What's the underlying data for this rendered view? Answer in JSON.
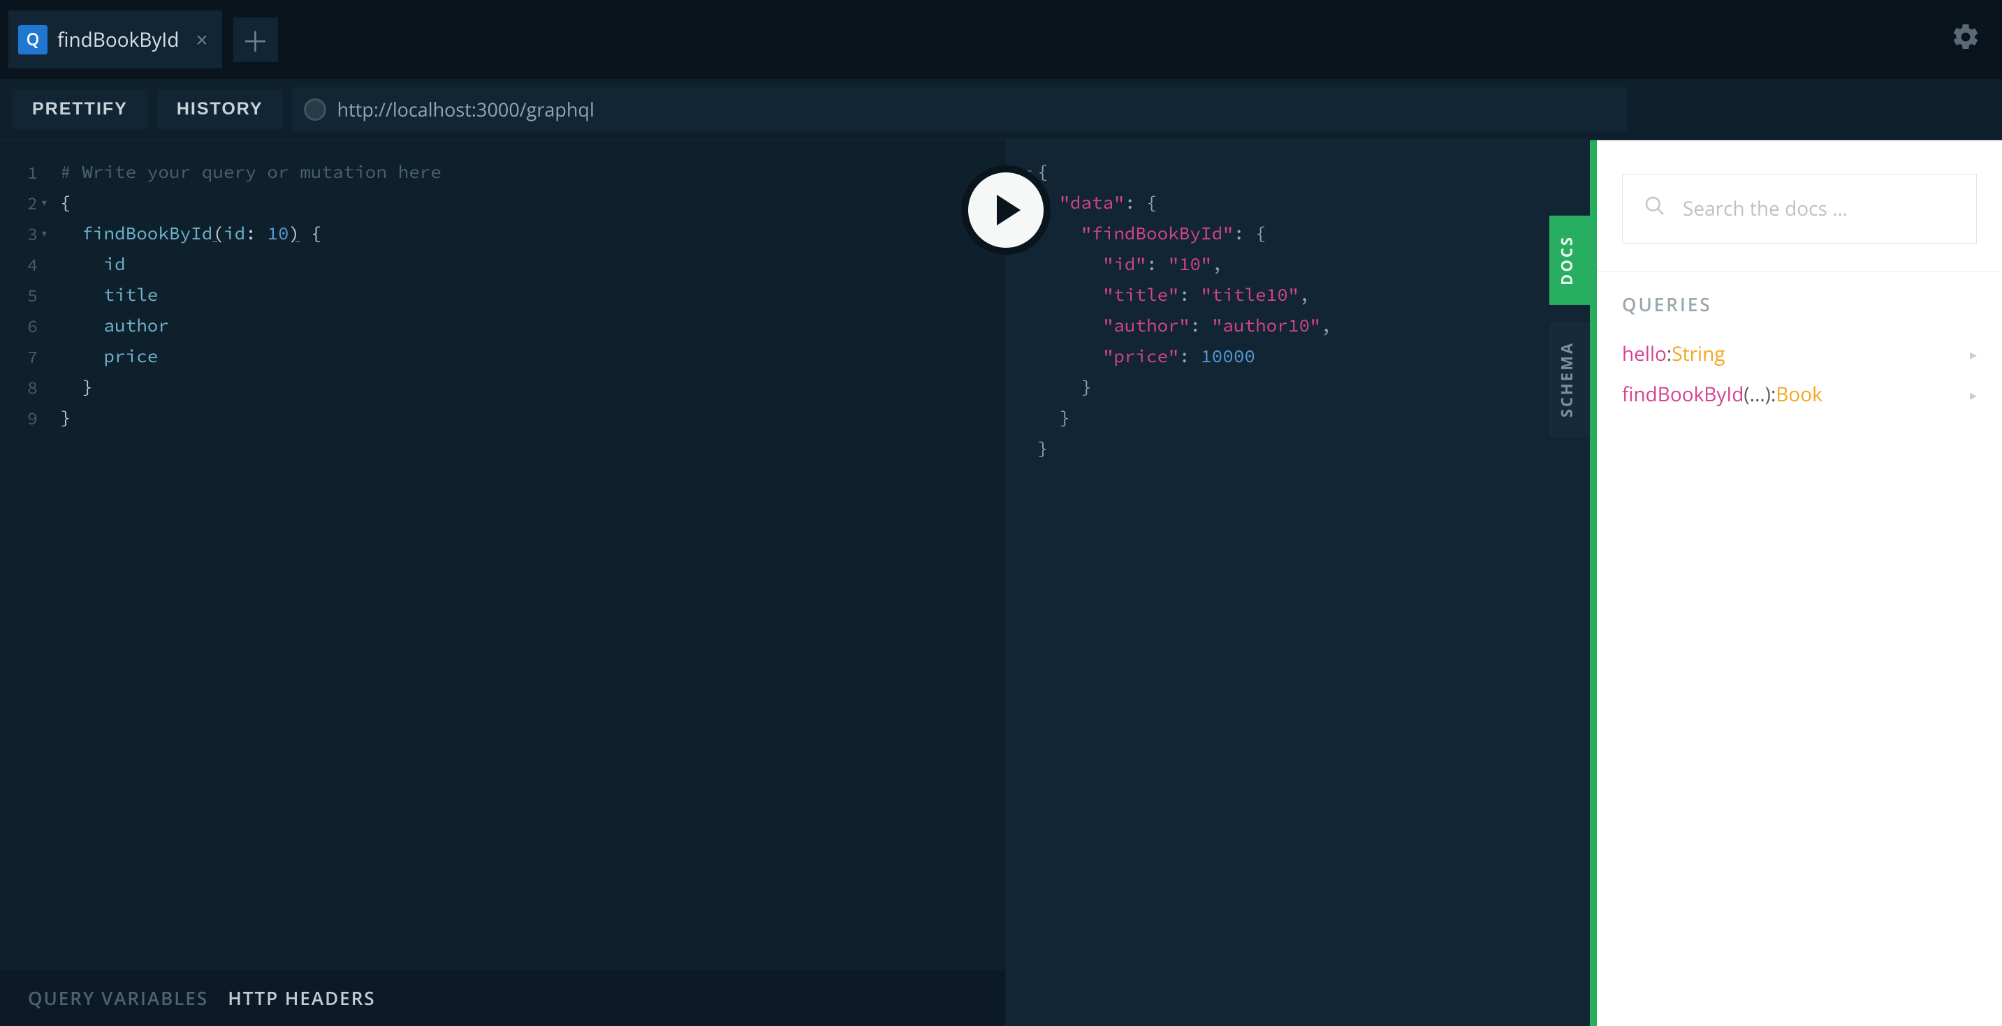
{
  "tabs": {
    "active": {
      "icon_letter": "Q",
      "title": "findBookById"
    }
  },
  "toolbar": {
    "prettify": "PRETTIFY",
    "history": "HISTORY",
    "endpoint": "http://localhost:3000/graphql"
  },
  "editor": {
    "lines": [
      "1",
      "2",
      "3",
      "4",
      "5",
      "6",
      "7",
      "8",
      "9"
    ],
    "folds": {
      "2": "▾",
      "3": "▾"
    },
    "code": {
      "l1_comment": "# Write your query or mutation here",
      "l2": "{",
      "l3_fn": "findBookById",
      "l3_arg": "id",
      "l3_val": "10",
      "l4": "id",
      "l5": "title",
      "l6": "author",
      "l7": "price",
      "l8": "}",
      "l9": "}"
    }
  },
  "bottom": {
    "vars": "QUERY VARIABLES",
    "headers": "HTTP HEADERS"
  },
  "result": {
    "folds": [
      "▾",
      "▾",
      "▾"
    ],
    "data_key": "\"data\"",
    "fbi_key": "\"findBookById\"",
    "id_k": "\"id\"",
    "id_v": "\"10\"",
    "title_k": "\"title\"",
    "title_v": "\"title10\"",
    "author_k": "\"author\"",
    "author_v": "\"author10\"",
    "price_k": "\"price\"",
    "price_v": "10000"
  },
  "side": {
    "docs": "DOCS",
    "schema": "SCHEMA"
  },
  "docs": {
    "search_placeholder": "Search the docs ...",
    "section": "QUERIES",
    "items": [
      {
        "name": "hello",
        "args": "",
        "colon": ": ",
        "type": "String"
      },
      {
        "name": "findBookById",
        "args": "(...)",
        "colon": ": ",
        "type": "Book"
      }
    ]
  }
}
